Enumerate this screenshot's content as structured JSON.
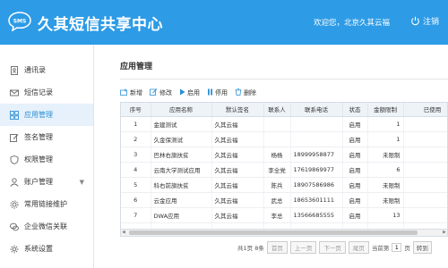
{
  "header": {
    "logo_text": "SMS",
    "title": "久其短信共享中心",
    "welcome": "欢迎您，北京久其云福",
    "logout": "注销"
  },
  "sidebar": {
    "items": [
      {
        "label": "通讯录",
        "icon": "contacts-icon"
      },
      {
        "label": "短信记录",
        "icon": "mail-icon"
      },
      {
        "label": "应用管理",
        "icon": "grid-icon",
        "active": true
      },
      {
        "label": "签名管理",
        "icon": "edit-icon"
      },
      {
        "label": "权限管理",
        "icon": "shield-icon"
      },
      {
        "label": "账户管理",
        "icon": "user-icon",
        "arrow": "▼"
      },
      {
        "label": "常用链接维护",
        "icon": "gear-icon"
      },
      {
        "label": "企业微信关联",
        "icon": "chat-icon"
      },
      {
        "label": "系统设置",
        "icon": "settings-icon"
      }
    ]
  },
  "main": {
    "title": "应用管理",
    "toolbar": {
      "add": "新增",
      "edit": "修改",
      "enable": "启用",
      "disable": "停用",
      "delete": "删除"
    },
    "table": {
      "headers": [
        "序号",
        "应用名称",
        "默认签名",
        "联系人",
        "联系电话",
        "状态",
        "金额限制",
        "已使用"
      ],
      "rows": [
        [
          "1",
          "金建测试",
          "久其云福",
          "",
          "",
          "启用",
          "1",
          ""
        ],
        [
          "2",
          "久金保测试",
          "久其云福",
          "",
          "",
          "启用",
          "1",
          ""
        ],
        [
          "3",
          "巴林右旗扶贫",
          "久其云福",
          "杨杨",
          "18999958877",
          "启用",
          "未限制",
          ""
        ],
        [
          "4",
          "云南大学测试应用",
          "久其云福",
          "李全党",
          "17619869977",
          "启用",
          "6",
          ""
        ],
        [
          "5",
          "科右前旗扶贫",
          "久其云福",
          "陈兵",
          "18907586986",
          "启用",
          "未限制",
          ""
        ],
        [
          "6",
          "云金应用",
          "久其云福",
          "武总",
          "18653601111",
          "启用",
          "未限制",
          ""
        ],
        [
          "7",
          "DWA应用",
          "久其云福",
          "李总",
          "13566685555",
          "启用",
          "13",
          ""
        ]
      ]
    },
    "pager": {
      "summary": "共1页 8条",
      "first": "首页",
      "prev": "上一页",
      "next": "下一页",
      "last": "尾页",
      "current_label": "当前第",
      "current_value": "1",
      "page_unit": "页",
      "go": "转到"
    }
  },
  "colors": {
    "header": "#2d9be6",
    "accent": "#2d8fd5",
    "active_bg": "#e6f1fb"
  }
}
